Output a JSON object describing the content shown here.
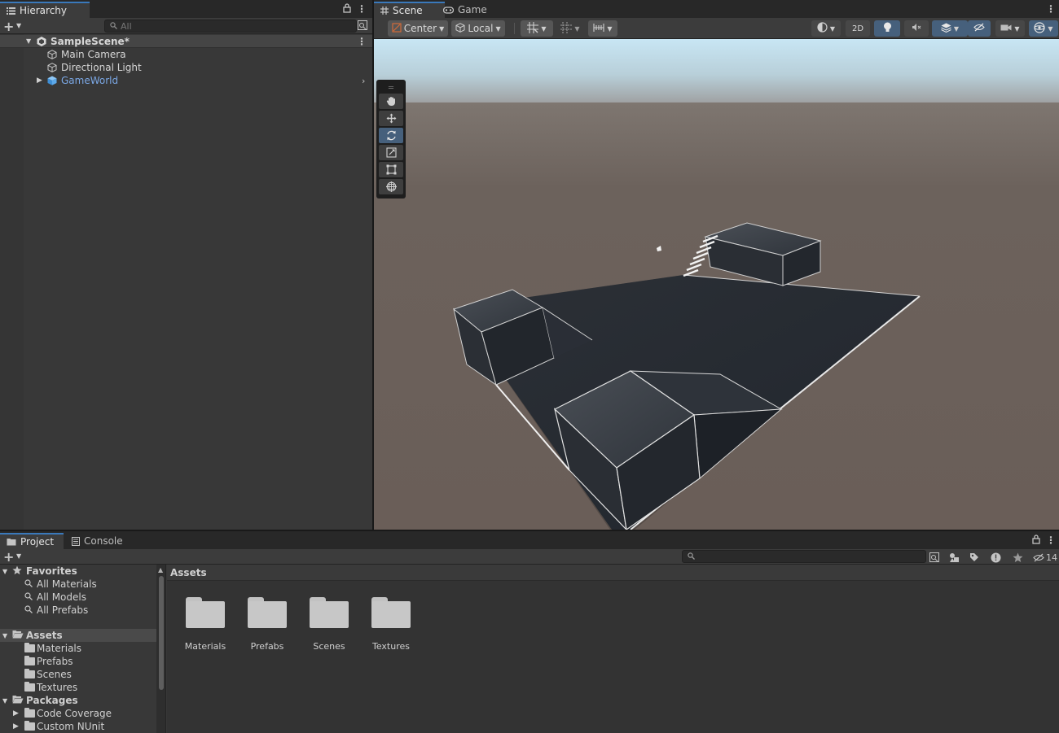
{
  "hierarchy": {
    "tab_label": "Hierarchy",
    "search_placeholder": "All",
    "scene_name": "SampleScene*",
    "items": [
      {
        "label": "Main Camera",
        "icon": "cube-outline-icon"
      },
      {
        "label": "Directional Light",
        "icon": "cube-outline-icon"
      },
      {
        "label": "GameWorld",
        "icon": "prefab-cube-icon",
        "prefab": true
      }
    ]
  },
  "scene": {
    "tabs": [
      {
        "label": "Scene",
        "icon": "grid-hash-icon"
      },
      {
        "label": "Game",
        "icon": "gamepad-icon"
      }
    ],
    "pivot_mode": "Center",
    "pivot_rotation": "Local",
    "mode_2d_label": "2D",
    "tools": [
      "hand-tool-icon",
      "move-tool-icon",
      "rotate-tool-icon",
      "scale-tool-icon",
      "rect-tool-icon",
      "transform-tool-icon"
    ],
    "selected_tool": "rotate-tool-icon"
  },
  "project": {
    "tabs": [
      {
        "label": "Project",
        "icon": "folder-icon"
      },
      {
        "label": "Console",
        "icon": "console-icon"
      }
    ],
    "hidden_count": "14",
    "favorites_label": "Favorites",
    "favorites": [
      "All Materials",
      "All Models",
      "All Prefabs"
    ],
    "assets_label": "Assets",
    "asset_folders": [
      "Materials",
      "Prefabs",
      "Scenes",
      "Textures"
    ],
    "packages_label": "Packages",
    "packages": [
      "Code Coverage",
      "Custom NUnit"
    ],
    "breadcrumb": "Assets",
    "grid_folders": [
      "Materials",
      "Prefabs",
      "Scenes",
      "Textures"
    ]
  },
  "colors": {
    "accent": "#3a79bb",
    "selected_tool": "#46607c",
    "prefab_text": "#7ba8e6",
    "sky": "#c4e2f2",
    "ground": "#6a5e58"
  }
}
